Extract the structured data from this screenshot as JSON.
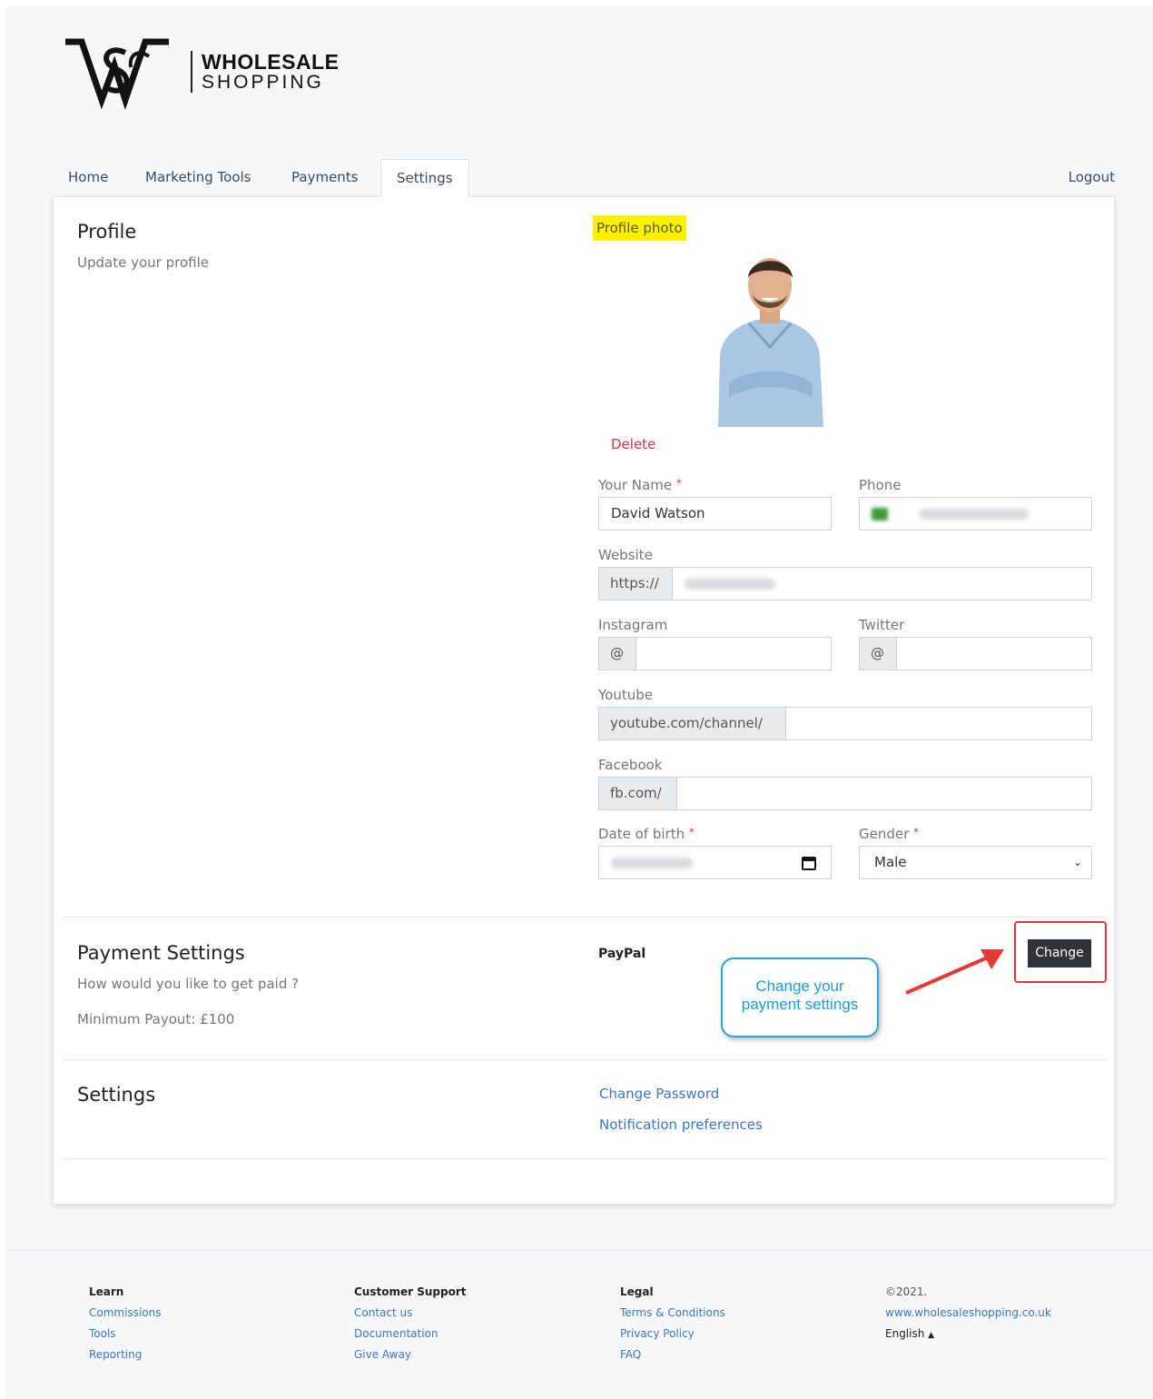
{
  "brand": {
    "line1": "WHOLESALE",
    "line2": "SHOPPING"
  },
  "nav": {
    "tabs": [
      {
        "label": "Home"
      },
      {
        "label": "Marketing Tools"
      },
      {
        "label": "Payments"
      },
      {
        "label": "Settings",
        "active": true
      }
    ],
    "logout": "Logout"
  },
  "profile": {
    "title": "Profile",
    "subtitle": "Update your profile",
    "photo_label": "Profile photo",
    "delete_label": "Delete",
    "fields": {
      "name_label": "Your Name",
      "name_value": "David Watson",
      "phone_label": "Phone",
      "website_label": "Website",
      "website_prefix": "https://",
      "instagram_label": "Instagram",
      "instagram_prefix": "@",
      "twitter_label": "Twitter",
      "twitter_prefix": "@",
      "youtube_label": "Youtube",
      "youtube_prefix": "youtube.com/channel/",
      "facebook_label": "Facebook",
      "facebook_prefix": "fb.com/",
      "dob_label": "Date of birth",
      "gender_label": "Gender",
      "gender_value": "Male",
      "required_mark": "*"
    }
  },
  "payment": {
    "title": "Payment Settings",
    "subtitle": "How would you like to get paid ?",
    "minimum": "Minimum Payout: £100",
    "method": "PayPal",
    "change_label": "Change",
    "callout_line1": "Change your",
    "callout_line2": "payment settings"
  },
  "settings": {
    "title": "Settings",
    "change_password": "Change Password",
    "notification_prefs": "Notification preferences"
  },
  "footer": {
    "learn": {
      "heading": "Learn",
      "links": [
        "Commissions",
        "Tools",
        "Reporting"
      ]
    },
    "support": {
      "heading": "Customer Support",
      "links": [
        "Contact us",
        "Documentation",
        "Give Away"
      ]
    },
    "legal": {
      "heading": "Legal",
      "links": [
        "Terms & Conditions",
        "Privacy Policy",
        "FAQ"
      ]
    },
    "meta": {
      "copyright": "©2021.",
      "site": "www.wholesaleshopping.co.uk",
      "language": "English"
    }
  },
  "colors": {
    "accent_link": "#3b77c6",
    "danger": "#dc3545",
    "highlight": "#fff200",
    "callout": "#29a8d8"
  }
}
